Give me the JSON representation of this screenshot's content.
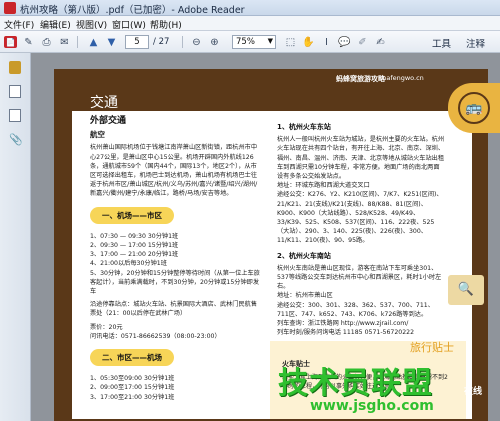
{
  "window": {
    "title": "杭州攻略（第八版）.pdf（已加密）- Adobe Reader"
  },
  "menu": [
    "文件(F)",
    "编辑(E)",
    "视图(V)",
    "窗口(W)",
    "帮助(H)"
  ],
  "toolbar": {
    "page_current": "5",
    "page_total": "/ 27",
    "zoom": "75%",
    "tools_label": "工具",
    "comment_label": "注释"
  },
  "page": {
    "header_brand": "蚂蜂窝旅游攻略",
    "header_site": "mafengwo.cn",
    "section_title": "交通",
    "left": {
      "h_out": "外部交通",
      "h_air": "航空",
      "p1": "杭州萧山国际机场位于钱塘江南岸萧山区新街镇，距杭州市中心27公里，是萧山区中心15公里。机场开辟国内外航线126条，通航城市59个（国内44个，国际13个，地区2个），从市区可选择出租车，机场巴士到达机场，萧山机场有机场巴士往返于杭州市区/萧山城区/杭州/义乌/苏州/嘉兴/诸暨/绍兴/湖州/新嘉兴/衢州/建宁/永康/临江，路桥/马场/安吉等地。",
      "pill1": "一、机场——市区",
      "s1": "1、07:30 — 09:30  30分钟1班",
      "s2": "2、09:30 — 17:00  15分钟1班",
      "s3": "3、17:00 — 21:00  20分钟1班",
      "s4": "4、21:00以后每30分钟1班",
      "s5": "5、30分钟，20分钟和15分钟整停等待时间（从第一位上车旅客起计），当前乘满载时，不到30分钟，20分钟或15分钟即发车",
      "route": "沿途停靠站点：城站火车站、杭景国际大酒店、武林门民航售票处（21：00以后停在武林广场）",
      "fare": "票价：20元",
      "tel": "问讯电话：0571-86662539（08:00-23:00）",
      "pill2": "二、市区——机场",
      "t1": "1、05:30至09:00  30分钟1班",
      "t2": "2、09:00至17:00  15分钟1班",
      "t3": "3、17:00至21:00  30分钟1班"
    },
    "right": {
      "h_east": "1、杭州火车东站",
      "p_east": "杭州人一般叫杭州火车站为城站，是杭州主要的火车站。杭州火车站现在共有四个站台，有开往上海、北京、南京、深圳、福州、南昌、温州、济南、天津、北京等地从城站火车站出租车到西湖只需10分钟车程，非常方便。地面广场的南北两面设有多条公交始发站点。",
      "addr_east": "地址：环城东路和西湖大道交叉口",
      "bus_east": "途经公交：K276、Y2、K210(区间)、7/K7、K251(区间)、21/K21、21(支线)/K21(支线)、88/K88、81(区间)、K900、K900（大站线路）、528/K528、49/K49、33/K39、525、K508、537(区间)、116、222夜、525（大站）、290、3、140、225(夜)、226(夜)、300、11/K11、210(夜)、90、95路。",
      "h_south": "2、杭州火车南站",
      "p_south": "杭州火车南站是萧山区现位，游客在南站下车可乘坐301、537等线路公交车到达杭州市中心和西湖景区，耗时1小时左右。",
      "addr_south": "地址：杭州市萧山区",
      "bus_south": "途经公交：300、301、328、362、537、700、711、711区、747、k652、743、K706、k726路等到达。",
      "web": "列车查询：浙江铁路网 http://www.zjrail.com/",
      "hotline": "列车时刻/服务问询电话 11185  0571-56720222"
    },
    "tip": {
      "title": "旅行贴士",
      "head": "火车贴士",
      "text": "乘坐：从上海到杭州的火车很方便，上海南站基本上只需不到2小时的车程，你可以事先购买好往返车票。"
    },
    "watermark": {
      "main": "技术员联盟",
      "url": "www.jsgho.com",
      "small": "在线"
    }
  },
  "icons": [
    "file-open-icon",
    "edit-icon",
    "print-icon",
    "email-icon",
    "up-arrow-icon",
    "down-arrow-icon",
    "zoom-out-icon",
    "zoom-in-icon",
    "pan-icon",
    "sidebar-pages-icon"
  ]
}
